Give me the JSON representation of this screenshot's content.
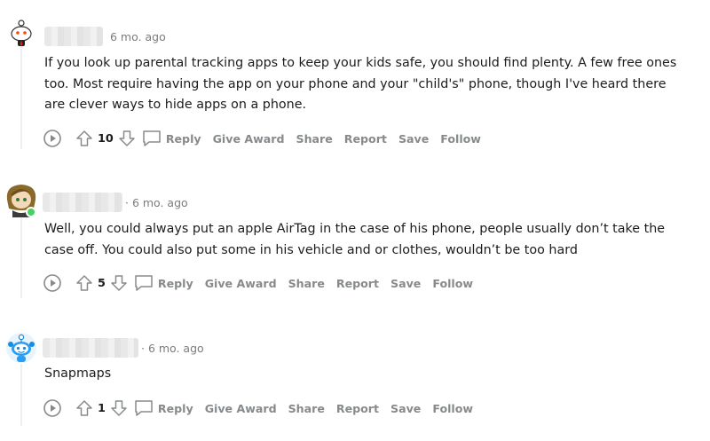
{
  "comments": [
    {
      "time": "6 mo. ago",
      "text": "If you look up parental tracking apps to keep your kids safe, you should find plenty. A few free ones too. Most require having the app on your phone and your \"child's\" phone, though I've heard there are clever ways to hide apps on a phone.",
      "votes": "10",
      "reply": "Reply",
      "give_award": "Give Award",
      "share": "Share",
      "report": "Report",
      "save": "Save",
      "follow": "Follow"
    },
    {
      "time": "· 6 mo. ago",
      "text": "Well, you could always put an apple AirTag in the case of his phone, people usually don’t take the case off. You could also put some in his vehicle and or clothes, wouldn’t be too hard",
      "votes": "5",
      "reply": "Reply",
      "give_award": "Give Award",
      "share": "Share",
      "report": "Report",
      "save": "Save",
      "follow": "Follow"
    },
    {
      "time": "· 6 mo. ago",
      "text": "Snapmaps",
      "votes": "1",
      "reply": "Reply",
      "give_award": "Give Award",
      "share": "Share",
      "report": "Report",
      "save": "Save",
      "follow": "Follow"
    }
  ],
  "colors": {
    "accent_online": "#46d160",
    "meta": "#7c7c7c",
    "action": "#878a8c"
  }
}
